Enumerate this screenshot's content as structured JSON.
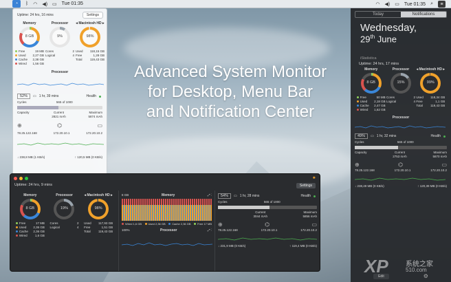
{
  "menubar": {
    "time": "Tue 01:35",
    "time_right": "Tue 01:35"
  },
  "headline": {
    "line1": "Advanced System Monitor",
    "line2": "for Desktop, Menu Bar",
    "line3": "and Notification Center"
  },
  "light_panel": {
    "uptime": "Uptime: 24 hrs, 16 mins",
    "settings": "Settings",
    "memory_title": "Memory",
    "processor_title": "Processor",
    "disk_title": "◂ Macintosh HD ▸",
    "memory_value": "8 GB",
    "processor_value": "9%",
    "disk_value": "98%",
    "mem_rows": [
      [
        "Free",
        "19 MB"
      ],
      [
        "Used",
        "2,27 GB"
      ],
      [
        "Cache",
        "2,38 GB"
      ],
      [
        "Wired",
        "1,56 GB"
      ]
    ],
    "proc_rows": [
      [
        "Cores",
        "2"
      ],
      [
        "Logical",
        "4"
      ]
    ],
    "disk_rows": [
      [
        "Used",
        "118,15 GB"
      ],
      [
        "Free",
        "1,28 GB"
      ],
      [
        "Total",
        "119,43 GB"
      ]
    ],
    "processor_label": "Processor",
    "battery_pct": "52%",
    "battery_time": "1 hr, 39 mins",
    "health": "Health",
    "cycles_label": "Cycles",
    "cycles_value": "565 of 1000",
    "capacity_label": "Capacity",
    "current_label": "Current",
    "current_value": "2821 mAh",
    "maximum_label": "Maximum",
    "maximum_value": "5874 mAh",
    "ip1": "78.25.122.168",
    "ip2": "172.20.10.1",
    "ip3": "172.20.10.2",
    "down": "238,8 MB (1 KB/s)",
    "up": "120,5 MB (0 KB/s)"
  },
  "dark_window": {
    "uptime": "Uptime: 24 hrs, 9 mins",
    "settings": "Settings",
    "memory_title": "Memory",
    "processor_title": "Processor",
    "disk_title": "◂ Macintosh HD ▸",
    "memory_value": "8 GB",
    "processor_value": "19%",
    "disk_value": "98%",
    "mem_rows": [
      [
        "Free",
        "17 MB"
      ],
      [
        "Used",
        "2,36 GB"
      ],
      [
        "Cache",
        "2,36 GB"
      ],
      [
        "Wired",
        "1,6 GB"
      ]
    ],
    "proc_rows": [
      [
        "Cores",
        "2"
      ],
      [
        "Logical",
        "4"
      ]
    ],
    "disk_rows": [
      [
        "Used",
        "117,93 GB"
      ],
      [
        "Free",
        "1,51 GB"
      ],
      [
        "Total",
        "119,43 GB"
      ]
    ],
    "chart_memory_title": "Memory",
    "chart_top_label": "8 GB",
    "legend": [
      [
        "Wired",
        "1,6 GB"
      ],
      [
        "Used",
        "2,36 GB"
      ],
      [
        "Cache",
        "2,36 GB"
      ],
      [
        "Free",
        "17 MB"
      ]
    ],
    "chart_processor_title": "Processor",
    "chart_pct": "100%",
    "battery_pct": "54%",
    "battery_time": "1 hr, 28 mins",
    "health": "Health",
    "cycles_label": "Cycles",
    "cycles_value": "565 of 1000",
    "capacity_label": "Capacity",
    "current_label": "Current",
    "current_value": "3044 mAh",
    "maximum_label": "Maximum",
    "maximum_value": "5856 mAh",
    "ip1": "78.25.122.168",
    "ip2": "172.20.10.1",
    "ip3": "172.20.10.2",
    "down": "231,9 MB (0 KB/s)",
    "up": "119,4 MB (0 KB/s)"
  },
  "notification": {
    "tab_today": "Today",
    "tab_notifications": "Notifications",
    "day": "Wednesday,",
    "date_num": "29",
    "date_suffix": "th",
    "month": "June",
    "section": "iStatistica",
    "uptime": "Uptime: 24 hrs, 17 mins",
    "memory_title": "Memory",
    "processor_title": "Processor",
    "disk_title": "◂ Macintosh HD ▸",
    "memory_value": "8 GB",
    "processor_value": "15%",
    "disk_value": "99%",
    "mem_rows": [
      [
        "Free",
        "50 MB"
      ],
      [
        "Used",
        "2,18 GB"
      ],
      [
        "Cache",
        "2,47 GB"
      ],
      [
        "Wired",
        "1,62 GB"
      ]
    ],
    "proc_rows": [
      [
        "Cores",
        "2"
      ],
      [
        "Logical",
        "4"
      ]
    ],
    "disk_rows": [
      [
        "Used",
        "118,34 GB"
      ],
      [
        "Free",
        "1,1 GB"
      ],
      [
        "Total",
        "119,43 GB"
      ]
    ],
    "processor_label": "Processor",
    "battery_pct": "49%",
    "battery_time": "1 hr, 32 mins",
    "health": "Health",
    "cycles_label": "Cycles",
    "cycles_value": "565 of 1000",
    "capacity_label": "Capacity",
    "current_label": "Current",
    "current_value": "2753 mAh",
    "maximum_label": "Maximum",
    "maximum_value": "5870 mAh",
    "ip1": "78.25.122.168",
    "ip2": "172.20.10.1",
    "ip3": "172.20.10.2",
    "down": "238,49 MB (0 KB/s)",
    "up": "120,39 MB (0 KB/s)",
    "edit": "Edit"
  },
  "watermark": {
    "brand": "XP",
    "brand_cn": "系统之家",
    "site": "510.com"
  },
  "colors": {
    "memory_ring": "#3a86d8",
    "processor_ring": "#9aa4ad",
    "disk_ring": "#f0a12b",
    "free": "#8fcf5b",
    "used": "#f0a12b",
    "cache": "#3a86d8",
    "wired": "#d9534f",
    "health": "#4caf50"
  }
}
